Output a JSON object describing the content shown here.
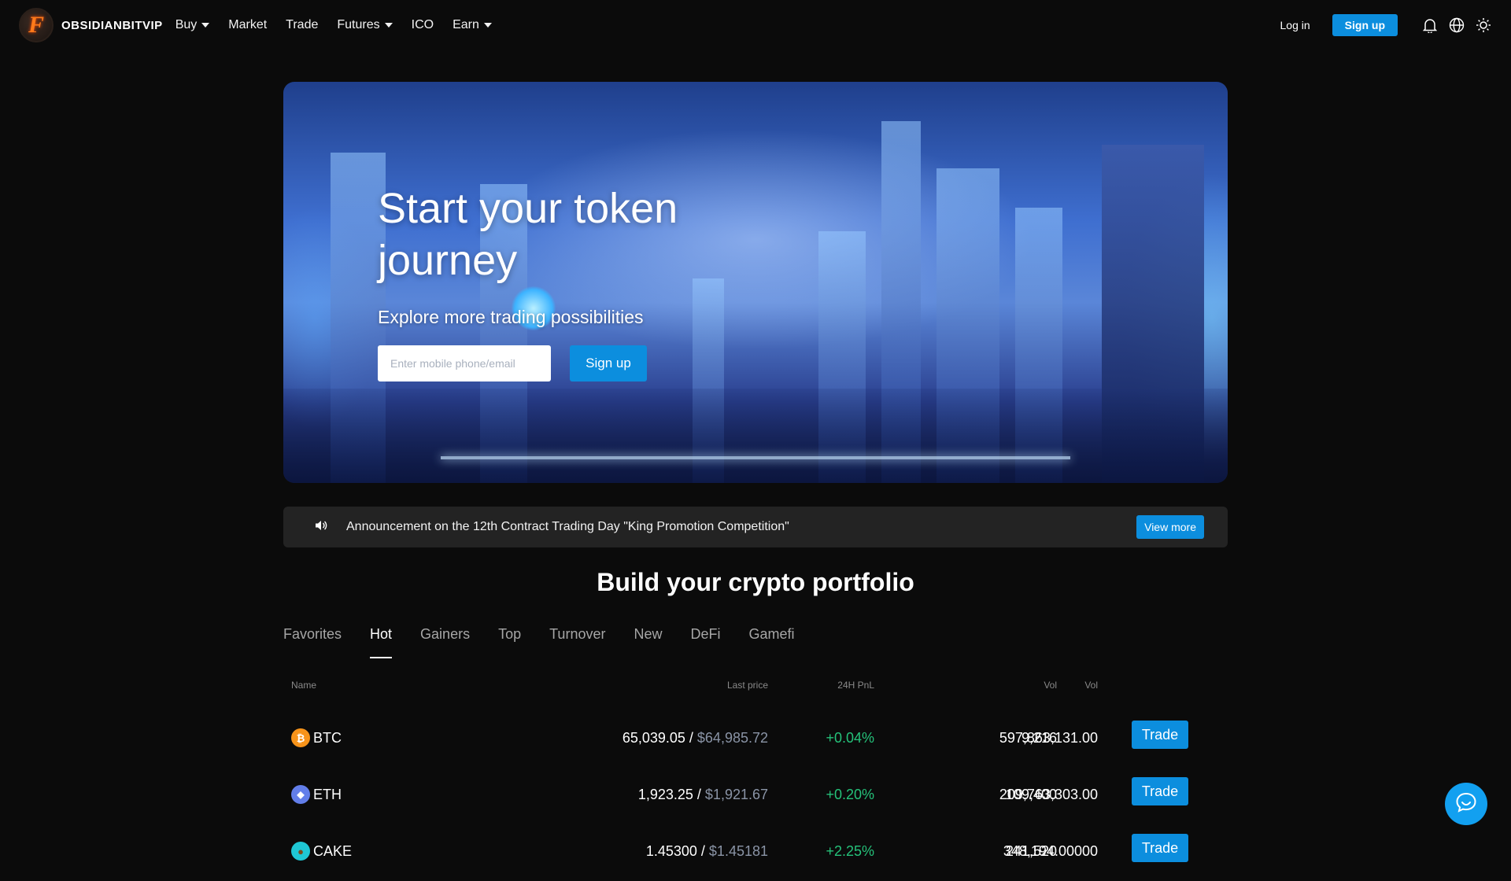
{
  "header": {
    "brand": "OBSIDIANBITVIP",
    "logo_letter": "F",
    "menu": [
      {
        "label": "Buy",
        "has_dropdown": true
      },
      {
        "label": "Market",
        "has_dropdown": false
      },
      {
        "label": "Trade",
        "has_dropdown": false
      },
      {
        "label": "Futures",
        "has_dropdown": true
      },
      {
        "label": "ICO",
        "has_dropdown": false
      },
      {
        "label": "Earn",
        "has_dropdown": true
      }
    ],
    "login_label": "Log in",
    "signup_label": "Sign up",
    "icons": [
      "bell-icon",
      "globe-icon",
      "sun-icon"
    ]
  },
  "hero": {
    "title": "Start your token journey",
    "subtitle": "Explore more trading possibilities",
    "input_placeholder": "Enter mobile phone/email",
    "signup_label": "Sign up"
  },
  "announcement": {
    "icon": "speaker-icon",
    "text": "Announcement on the 12th Contract Trading Day \"King Promotion Competition\"",
    "view_more_label": "View more"
  },
  "portfolio": {
    "title": "Build your crypto portfolio",
    "tabs": [
      "Favorites",
      "Hot",
      "Gainers",
      "Top",
      "Turnover",
      "New",
      "DeFi",
      "Gamefi"
    ],
    "active_tab": "Hot",
    "columns": {
      "name": "Name",
      "last_price": "Last price",
      "pnl": "24H PnL",
      "vol": "Vol",
      "vol2": "Vol"
    },
    "rows": [
      {
        "symbol": "BTC",
        "icon": "bitcoin-icon",
        "icon_char": "₿",
        "icon_color": "#f7931a",
        "price": "65,039.05",
        "price_usd": "$64,985.72",
        "pnl": "+0.04%",
        "vol": "9,216",
        "turnover": "597,863,131.00",
        "trade_label": "Trade"
      },
      {
        "symbol": "ETH",
        "icon": "ethereum-icon",
        "icon_char": "◆",
        "icon_color": "#627eea",
        "price": "1,923.25",
        "price_usd": "$1,921.67",
        "pnl": "+0.20%",
        "vol": "109,400",
        "turnover": "209,763,303.00",
        "trade_label": "Trade"
      },
      {
        "symbol": "CAKE",
        "icon": "pancakeswap-icon",
        "icon_char": "●",
        "icon_color": "#1fc7d4",
        "price": "1.45300",
        "price_usd": "$1.45181",
        "pnl": "+2.25%",
        "vol": "241,520",
        "turnover": "348,194.00000",
        "trade_label": "Trade"
      }
    ]
  },
  "colors": {
    "accent": "#0c8ede",
    "positive": "#25c27a",
    "background": "#0b0b0b",
    "panel": "#232323"
  }
}
